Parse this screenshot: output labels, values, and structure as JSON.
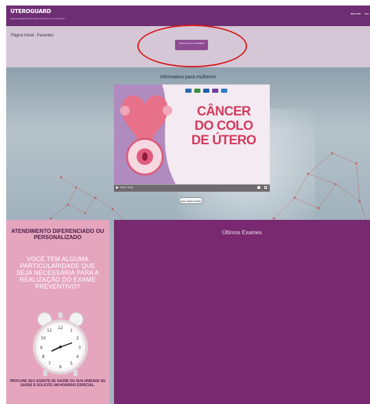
{
  "app": {
    "brand": "ÚTEROGUARD",
    "brand_tagline": "Agenda inteligente para exames preventivos de colo uterino",
    "nav": [
      "Meu Perfil",
      "Sair"
    ]
  },
  "subbar": {
    "breadcrumb": "Página Inicial - Pacientes",
    "cta_label": "Próximo Exame 14/03/2024"
  },
  "hero": {
    "section_title": "Informativo para mulheres",
    "video": {
      "title_line1": "CÂNCER",
      "title_line2": "DO COLO",
      "title_line3": "DE ÚTERO",
      "time": "0:00 / 3:15"
    },
    "more_button": "Quer saber mais?"
  },
  "left_panel": {
    "heading": "ATENDIMENTO DIFERENCIADO OU PERSONALIZADO",
    "question": "VOCÊ TEM ALGUMA PARTICULARIDADE QUE SEJA NECESSÁRIA PARA A REALIZAÇÃO DO EXAME PREVENTIVO?",
    "footer": "PROCURE SEU AGENTE DE SAÚDE OU SUA UNIDADE DE SAÚDE E SOLICITE UM HORÁRIO ESPECIAL."
  },
  "right_panel": {
    "title": "Últimos Exames"
  },
  "colors": {
    "brand": "#6e2e74",
    "accent": "#8f4b92",
    "highlight": "#d51a1a",
    "video_title": "#d23a5d"
  }
}
